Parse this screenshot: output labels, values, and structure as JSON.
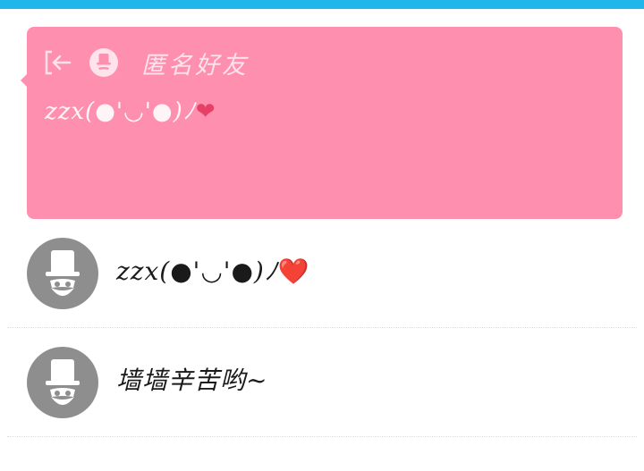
{
  "colors": {
    "topbar": "#1fb7eb",
    "card_background": "#ff8faf",
    "avatar": "#8e8e8e"
  },
  "card": {
    "icons": [
      "exit-icon",
      "anonymous-mask-icon"
    ],
    "title": "匿名好友",
    "message_prefix": "zzx(",
    "message_face": "●'◡'●",
    "message_suffix": ")ﾉ",
    "message_emoji": "❤"
  },
  "messages": [
    {
      "avatar_icon": "anonymous-mask-icon",
      "text_prefix": "zzx(",
      "text_face": "●'◡'●",
      "text_suffix": ")ﾉ",
      "emoji": "❤️"
    },
    {
      "avatar_icon": "anonymous-mask-icon",
      "text": "墙墙辛苦哟~"
    }
  ]
}
